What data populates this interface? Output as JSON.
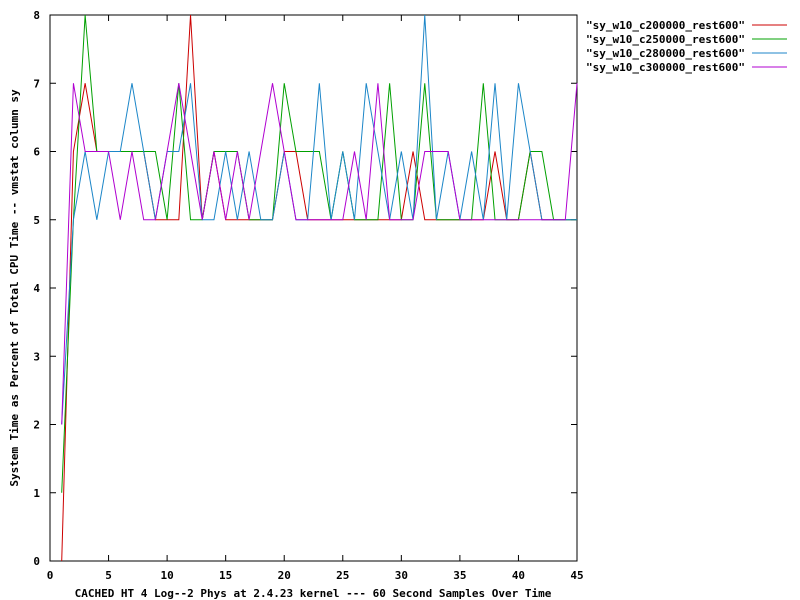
{
  "chart_data": {
    "type": "line",
    "xlabel": "CACHED HT 4 Log--2 Phys at 2.4.23 kernel --- 60 Second Samples Over Time",
    "ylabel": "System Time as Percent of Total CPU Time -- vmstat column sy",
    "xlim": [
      0,
      45
    ],
    "ylim": [
      0,
      8
    ],
    "xticks": [
      0,
      5,
      10,
      15,
      20,
      25,
      30,
      35,
      40,
      45
    ],
    "yticks": [
      0,
      1,
      2,
      3,
      4,
      5,
      6,
      7,
      8
    ],
    "grid": false,
    "legend_position": "top-right",
    "series": [
      {
        "name": "\"sy_w10_c200000_rest600\"",
        "color": "#cc0000",
        "x": [
          1,
          2,
          3,
          4,
          5,
          6,
          7,
          8,
          9,
          10,
          11,
          12,
          13,
          14,
          15,
          16,
          17,
          18,
          19,
          20,
          21,
          22,
          23,
          24,
          25,
          26,
          27,
          28,
          29,
          30,
          31,
          32,
          33,
          34,
          35,
          36,
          37,
          38,
          39,
          40,
          41,
          42,
          43,
          44,
          45
        ],
        "y": [
          0,
          6,
          7,
          6,
          6,
          6,
          6,
          6,
          5,
          5,
          5,
          8,
          5,
          6,
          5,
          5,
          5,
          5,
          5,
          6,
          6,
          5,
          5,
          5,
          5,
          5,
          5,
          5,
          5,
          5,
          6,
          5,
          5,
          5,
          5,
          5,
          5,
          6,
          5,
          5,
          6,
          5,
          5,
          5,
          5
        ]
      },
      {
        "name": "\"sy_w10_c250000_rest600\"",
        "color": "#00a000",
        "x": [
          1,
          2,
          3,
          4,
          5,
          6,
          7,
          8,
          9,
          10,
          11,
          12,
          13,
          14,
          15,
          16,
          17,
          18,
          19,
          20,
          21,
          22,
          23,
          24,
          25,
          26,
          27,
          28,
          29,
          30,
          31,
          32,
          33,
          34,
          35,
          36,
          37,
          38,
          39,
          40,
          41,
          42,
          43,
          44,
          45
        ],
        "y": [
          1,
          5,
          8,
          6,
          6,
          6,
          6,
          6,
          6,
          5,
          7,
          5,
          5,
          6,
          6,
          6,
          5,
          5,
          5,
          7,
          6,
          6,
          6,
          5,
          6,
          5,
          5,
          5,
          7,
          5,
          5,
          7,
          5,
          5,
          5,
          5,
          7,
          5,
          5,
          5,
          6,
          6,
          5,
          5,
          5
        ]
      },
      {
        "name": "\"sy_w10_c280000_rest600\"",
        "color": "#1c86c8",
        "x": [
          1,
          2,
          3,
          4,
          5,
          6,
          7,
          8,
          9,
          10,
          11,
          12,
          13,
          14,
          15,
          16,
          17,
          18,
          19,
          20,
          21,
          22,
          23,
          24,
          25,
          26,
          27,
          28,
          29,
          30,
          31,
          32,
          33,
          34,
          35,
          36,
          37,
          38,
          39,
          40,
          41,
          42,
          43,
          44,
          45
        ],
        "y": [
          2,
          5,
          6,
          5,
          6,
          6,
          7,
          6,
          5,
          6,
          6,
          7,
          5,
          5,
          6,
          5,
          6,
          5,
          5,
          6,
          5,
          5,
          7,
          5,
          6,
          5,
          7,
          6,
          5,
          6,
          5,
          8,
          5,
          6,
          5,
          6,
          5,
          7,
          5,
          7,
          6,
          5,
          5,
          5,
          5
        ]
      },
      {
        "name": "\"sy_w10_c300000_rest600\"",
        "color": "#b000d0",
        "x": [
          1,
          2,
          3,
          4,
          5,
          6,
          7,
          8,
          9,
          10,
          11,
          12,
          13,
          14,
          15,
          16,
          17,
          18,
          19,
          20,
          21,
          22,
          23,
          24,
          25,
          26,
          27,
          28,
          29,
          30,
          31,
          32,
          33,
          34,
          35,
          36,
          37,
          38,
          39,
          40,
          41,
          42,
          43,
          44,
          45
        ],
        "y": [
          2,
          7,
          6,
          6,
          6,
          5,
          6,
          5,
          5,
          6,
          7,
          6,
          5,
          6,
          5,
          6,
          5,
          6,
          7,
          6,
          5,
          5,
          5,
          5,
          5,
          6,
          5,
          7,
          5,
          5,
          5,
          6,
          6,
          6,
          5,
          5,
          5,
          5,
          5,
          5,
          5,
          5,
          5,
          5,
          7
        ]
      }
    ]
  }
}
